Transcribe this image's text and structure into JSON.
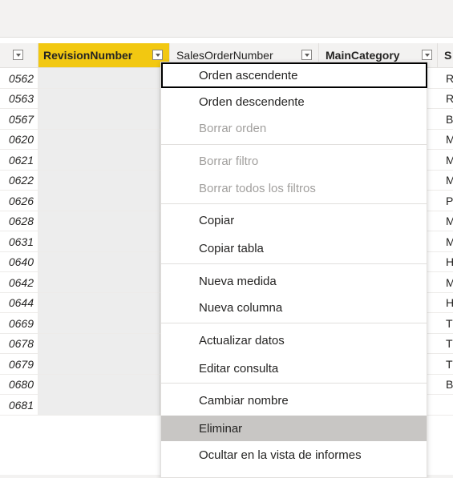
{
  "headers": [
    {
      "label": "",
      "name": "col-prev"
    },
    {
      "label": "RevisionNumber",
      "name": "col-revisionnumber"
    },
    {
      "label": "SalesOrderNumber",
      "name": "col-salesordernumber"
    },
    {
      "label": "MainCategory",
      "name": "col-maincategory"
    },
    {
      "label": "S",
      "name": "col-next"
    }
  ],
  "rows": [
    {
      "id": "0562",
      "next": "R"
    },
    {
      "id": "0563",
      "next": "R"
    },
    {
      "id": "0567",
      "next": "B"
    },
    {
      "id": "0620",
      "next": "M"
    },
    {
      "id": "0621",
      "next": "M"
    },
    {
      "id": "0622",
      "next": "M"
    },
    {
      "id": "0626",
      "next": "P"
    },
    {
      "id": "0628",
      "next": "M"
    },
    {
      "id": "0631",
      "next": "M"
    },
    {
      "id": "0640",
      "next": "H"
    },
    {
      "id": "0642",
      "next": "M"
    },
    {
      "id": "0644",
      "next": "H"
    },
    {
      "id": "0669",
      "next": "T"
    },
    {
      "id": "0678",
      "next": "T"
    },
    {
      "id": "0679",
      "next": "T"
    },
    {
      "id": "0680",
      "next": "B"
    },
    {
      "id": "0681",
      "next": ""
    }
  ],
  "menu": {
    "items": [
      {
        "label": "Orden ascendente",
        "state": "focused",
        "name": "menu-sort-ascending"
      },
      {
        "label": "Orden descendente",
        "state": "normal",
        "name": "menu-sort-descending"
      },
      {
        "label": "Borrar orden",
        "state": "disabled",
        "name": "menu-clear-sort"
      },
      {
        "label": "Borrar filtro",
        "state": "disabled",
        "name": "menu-clear-filter"
      },
      {
        "label": "Borrar todos los filtros",
        "state": "disabled",
        "name": "menu-clear-all-filters"
      },
      {
        "label": "Copiar",
        "state": "normal",
        "name": "menu-copy"
      },
      {
        "label": "Copiar tabla",
        "state": "normal",
        "name": "menu-copy-table"
      },
      {
        "label": "Nueva medida",
        "state": "normal",
        "name": "menu-new-measure"
      },
      {
        "label": "Nueva columna",
        "state": "normal",
        "name": "menu-new-column"
      },
      {
        "label": "Actualizar datos",
        "state": "normal",
        "name": "menu-refresh-data"
      },
      {
        "label": "Editar consulta",
        "state": "normal",
        "name": "menu-edit-query"
      },
      {
        "label": "Cambiar nombre",
        "state": "normal",
        "name": "menu-rename"
      },
      {
        "label": "Eliminar",
        "state": "hover",
        "name": "menu-delete"
      },
      {
        "label": "Ocultar en la vista de informes",
        "state": "normal",
        "name": "menu-hide-in-report-view"
      }
    ]
  }
}
